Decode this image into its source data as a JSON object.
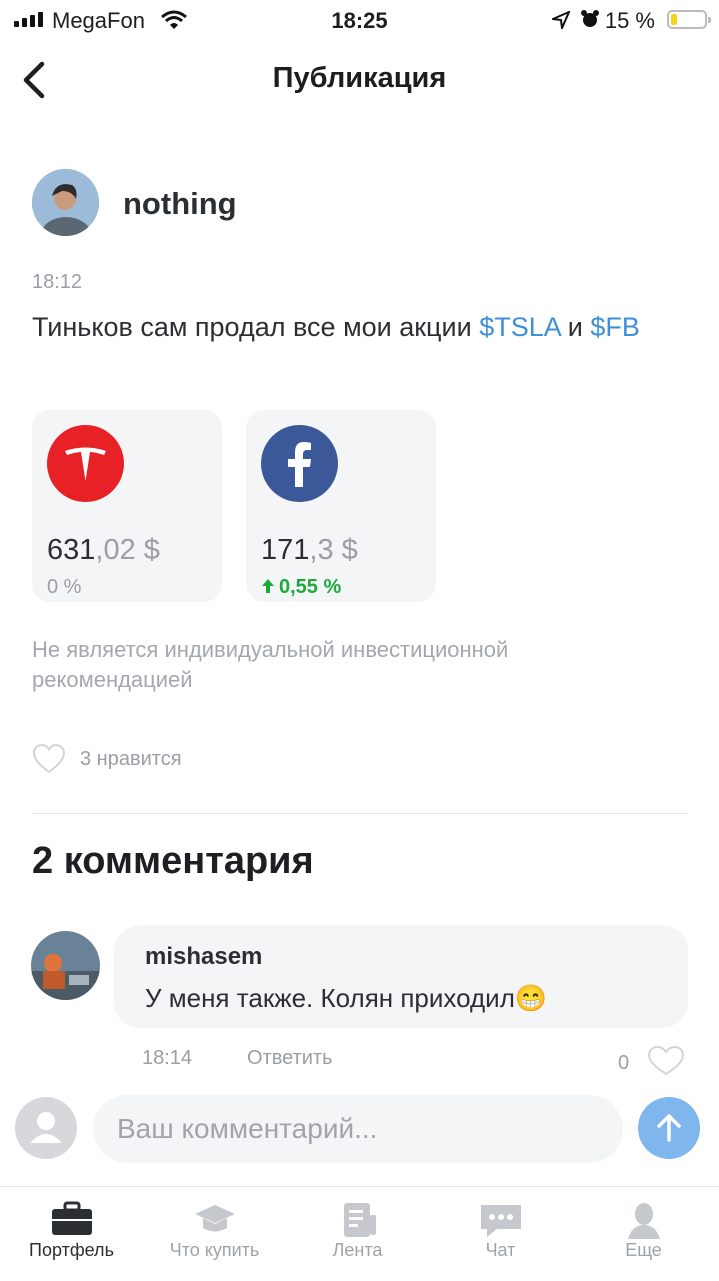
{
  "status": {
    "carrier": "MegaFon",
    "time": "18:25",
    "battery": "15 %"
  },
  "header": {
    "title": "Публикация"
  },
  "post": {
    "author": "nothing",
    "time": "18:12",
    "text_before": "Тиньков сам продал все мои акции ",
    "ticker1": "$TSLA",
    "text_mid": " и ",
    "ticker2": "$FB",
    "cards": [
      {
        "int": "631",
        "dec": ",02 $",
        "change": "0 %",
        "logo": "tesla-logo"
      },
      {
        "int": "171",
        "dec": ",3 $",
        "change": "0,55 %",
        "change_icon": "arrow-up-icon",
        "logo": "facebook-logo"
      }
    ],
    "disclaimer": "Не является индивидуальной инвестиционной рекомендацией",
    "likes": "3 нравится"
  },
  "comments": {
    "title": "2 комментария",
    "items": [
      {
        "author": "mishasem",
        "text": "У меня также. Колян приходил",
        "emoji": "😁",
        "time": "18:14",
        "reply": "Ответить",
        "likes": "0"
      }
    ]
  },
  "composer": {
    "placeholder": "Ваш комментарий..."
  },
  "tabs": [
    {
      "label": "Портфель",
      "icon": "briefcase-icon"
    },
    {
      "label": "Что купить",
      "icon": "graduation-cap-icon"
    },
    {
      "label": "Лента",
      "icon": "feed-icon"
    },
    {
      "label": "Чат",
      "icon": "chat-icon"
    },
    {
      "label": "Еще",
      "icon": "profile-icon"
    }
  ],
  "colors": {
    "ticker": "#3f8fd8",
    "positive": "#1ea83c",
    "tesla": "#e82127",
    "facebook": "#3b5998",
    "send": "#7fb6ee"
  }
}
